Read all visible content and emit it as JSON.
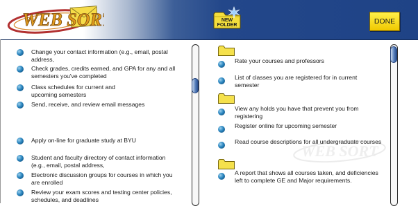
{
  "app": {
    "name": "WebSort"
  },
  "header": {
    "logo_text": "WEB SORT",
    "new_folder_label": "NEW FOLDER",
    "done_label": "DONE"
  },
  "left_panel": {
    "items": [
      {
        "label": "Change your contact information (e.g., email, postal address,"
      },
      {
        "label": "Check grades, credits earned, and GPA for any and all semesters you've completed"
      },
      {
        "label": "Class schedules for current and upcoming semesters"
      },
      {
        "label": "Send, receive, and review email messages"
      },
      {
        "label": "Apply on-line for graduate study at BYU"
      },
      {
        "label": "Student and faculty directory of contact information (e.g., email, postal address,"
      },
      {
        "label": "Electronic discussion groups for courses in which you are enrolled"
      },
      {
        "label": "Review your exam scores and testing center policies, schedules, and deadlines"
      }
    ]
  },
  "right_panel": {
    "items": [
      {
        "label": "Rate your courses and professors"
      },
      {
        "label": "List of classes you are registered for in current semester"
      },
      {
        "label": "View any holds you have that prevent you from registering"
      },
      {
        "label": "Register online for upcoming semester"
      },
      {
        "label": "Read course descriptions for all undergraduate courses"
      },
      {
        "label": "A report that shows all courses taken, and deficiencies left to complete GE and Major requirements."
      }
    ]
  },
  "watermark_text": "WEB SORT",
  "colors": {
    "header_dark": "#1f4386",
    "done_button": "#f6dc14",
    "folder": "#f5e14c",
    "bullet": "#2a86c0"
  }
}
